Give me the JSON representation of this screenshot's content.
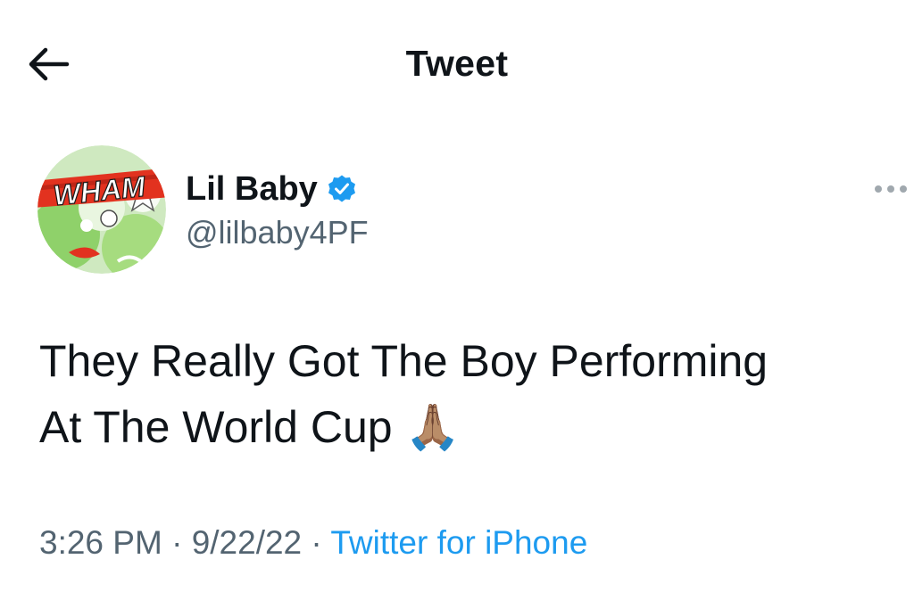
{
  "header": {
    "title": "Tweet",
    "back_icon": "arrow-left-icon"
  },
  "author": {
    "display_name": "Lil Baby",
    "handle": "@lilbaby4PF",
    "verified": true,
    "verified_color": "#1d9bf0",
    "avatar_text": "WHAM"
  },
  "more_icon": "ellipsis-icon",
  "tweet": {
    "text": "They Really Got The Boy Performing\nAt The World Cup 🙏🏽"
  },
  "meta": {
    "time": "3:26 PM",
    "separator": "·",
    "date": "9/22/22",
    "source": "Twitter for iPhone"
  },
  "colors": {
    "primary_text": "#0f1419",
    "secondary_text": "#536471",
    "accent": "#1d9bf0"
  }
}
